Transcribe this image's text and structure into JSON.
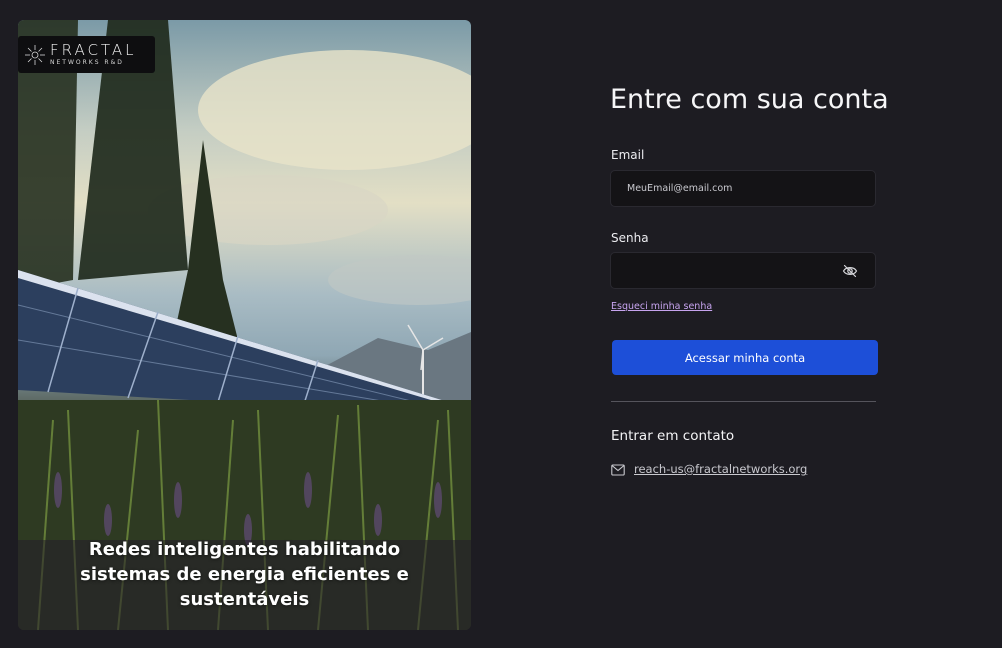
{
  "brand": {
    "name": "FRACTAL",
    "subtitle": "NETWORKS R&D"
  },
  "hero": {
    "caption_line1": "Redes inteligentes habilitando",
    "caption_line2": "sistemas de energia eficientes e sustentáveis"
  },
  "login": {
    "title": "Entre com sua conta",
    "email_label": "Email",
    "email_placeholder": "MeuEmail@email.com",
    "password_label": "Senha",
    "password_value": "",
    "forgot_link": "Esqueci minha senha",
    "submit_label": "Acessar minha conta"
  },
  "contact": {
    "title": "Entrar em contato",
    "email": "reach-us@fractalnetworks.org",
    "icon": "mail-icon"
  },
  "colors": {
    "background": "#1d1c22",
    "accent": "#1d4fd8",
    "link": "#c7a4ef"
  }
}
